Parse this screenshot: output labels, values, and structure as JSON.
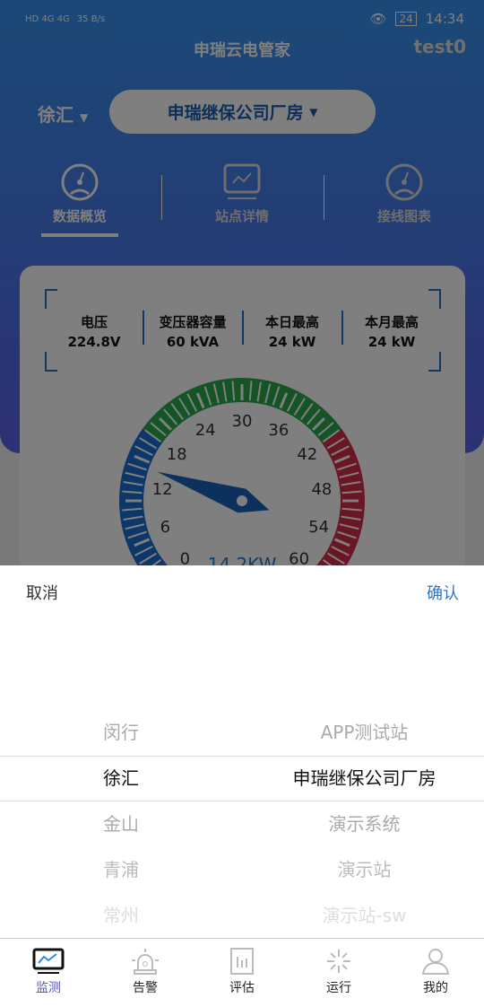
{
  "status_bar": {
    "network": "HD 4G 4G",
    "speed": "35 B/s",
    "battery": "24",
    "time": "14:34"
  },
  "header": {
    "title": "申瑞云电管家",
    "user": "test0"
  },
  "selectors": {
    "district": "徐汇",
    "site": "申瑞继保公司厂房"
  },
  "tabs": [
    {
      "label": "数据概览",
      "icon": "gauge-icon",
      "active": true
    },
    {
      "label": "站点详情",
      "icon": "monitor-chart-icon"
    },
    {
      "label": "接线图表",
      "icon": "gauge-icon"
    }
  ],
  "stats": [
    {
      "label": "电压",
      "value": "224.8V"
    },
    {
      "label": "变压器容量",
      "value": "60 kVA"
    },
    {
      "label": "本日最高",
      "value": "24 kW"
    },
    {
      "label": "本月最高",
      "value": "24 kW"
    }
  ],
  "gauge": {
    "min": 0,
    "max": 60,
    "value": 14.2,
    "value_label": "14.2KW",
    "ticks": [
      "0",
      "6",
      "12",
      "18",
      "24",
      "30",
      "36",
      "42",
      "48",
      "54",
      "60"
    ],
    "bands": [
      {
        "from": 0,
        "to": 18,
        "color": "#1a6fd0"
      },
      {
        "from": 18,
        "to": 42,
        "color": "#2aa84a"
      },
      {
        "from": 42,
        "to": 60,
        "color": "#d42c4a"
      }
    ]
  },
  "picker": {
    "cancel": "取消",
    "confirm": "确认",
    "districts": [
      "闵行",
      "徐汇",
      "金山",
      "青浦",
      "常州"
    ],
    "sites": [
      "APP测试站",
      "申瑞继保公司厂房",
      "演示系统",
      "演示站",
      "演示站-sw"
    ],
    "selected_index": 1
  },
  "bottom_nav": [
    {
      "label": "监测",
      "icon": "monitor-icon",
      "active": true
    },
    {
      "label": "告警",
      "icon": "alarm-icon"
    },
    {
      "label": "评估",
      "icon": "report-icon"
    },
    {
      "label": "运行",
      "icon": "loading-icon"
    },
    {
      "label": "我的",
      "icon": "user-icon"
    }
  ],
  "colors": {
    "accent": "#2f73c8",
    "active_nav": "#5a5aa8"
  }
}
